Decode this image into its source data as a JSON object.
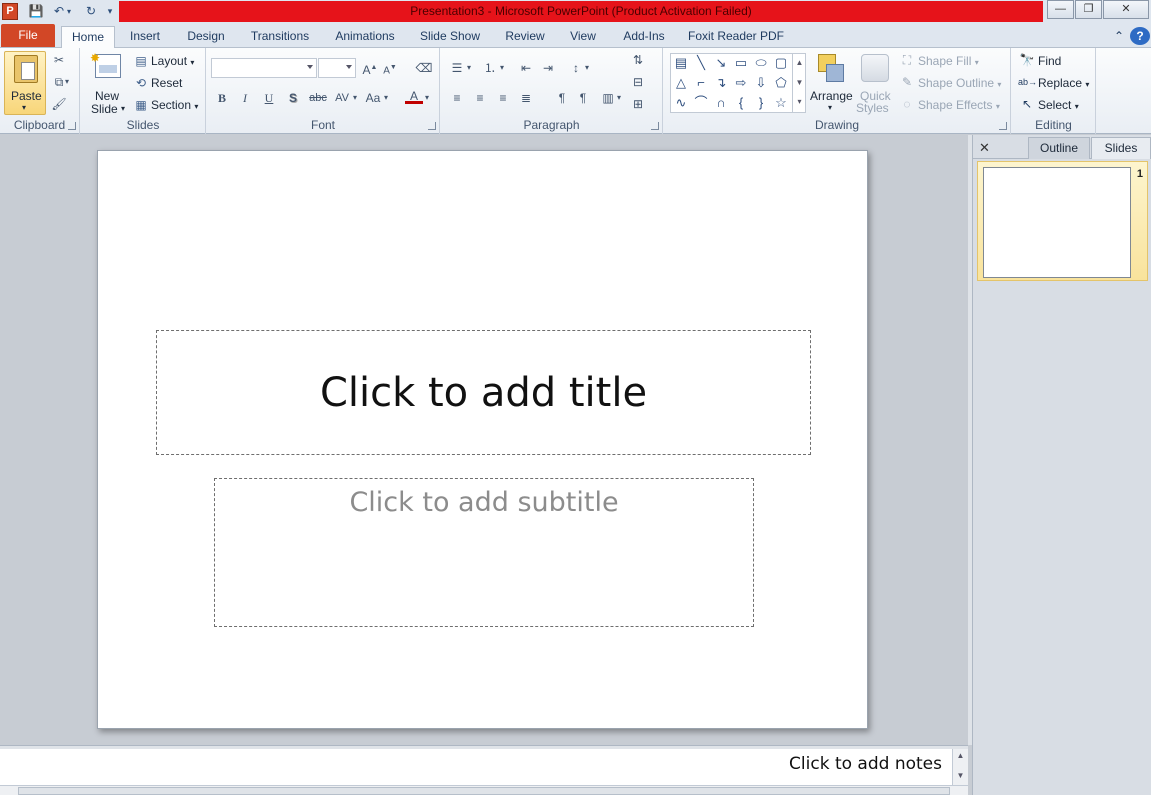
{
  "window": {
    "title": "Presentation3  -  Microsoft PowerPoint (Product Activation Failed)",
    "app_icon_letter": "P",
    "title_color": "#e6131a"
  },
  "tabs": [
    {
      "label": "File"
    },
    {
      "label": "Home"
    },
    {
      "label": "Insert"
    },
    {
      "label": "Design"
    },
    {
      "label": "Transitions"
    },
    {
      "label": "Animations"
    },
    {
      "label": "Slide Show"
    },
    {
      "label": "Review"
    },
    {
      "label": "View"
    },
    {
      "label": "Add-Ins"
    },
    {
      "label": "Foxit Reader PDF"
    }
  ],
  "active_tab": "Home",
  "ribbon": {
    "clipboard": {
      "label": "Clipboard",
      "paste": "Paste"
    },
    "slides": {
      "label": "Slides",
      "new_slide_line1": "New",
      "new_slide_line2": "Slide",
      "layout": "Layout",
      "reset": "Reset",
      "section": "Section"
    },
    "font": {
      "label": "Font",
      "bold": "B",
      "italic": "I",
      "underline": "U",
      "shadow": "S",
      "strike": "abc",
      "spacing": "AV",
      "case": "Aa",
      "color": "A"
    },
    "paragraph": {
      "label": "Paragraph"
    },
    "drawing": {
      "label": "Drawing",
      "arrange": "Arrange",
      "quick_styles_line1": "Quick",
      "quick_styles_line2": "Styles",
      "shape_fill": "Shape Fill",
      "shape_outline": "Shape Outline",
      "shape_effects": "Shape Effects"
    },
    "editing": {
      "label": "Editing",
      "find": "Find",
      "replace": "Replace",
      "select": "Select"
    }
  },
  "slide": {
    "title_placeholder": "Click to add title",
    "subtitle_placeholder": "Click to add subtitle"
  },
  "slides_pane": {
    "tabs": [
      "Outline",
      "Slides"
    ],
    "active": "Slides",
    "thumbnails": [
      {
        "number": "1"
      }
    ]
  },
  "notes": {
    "placeholder": "Click to add notes"
  }
}
